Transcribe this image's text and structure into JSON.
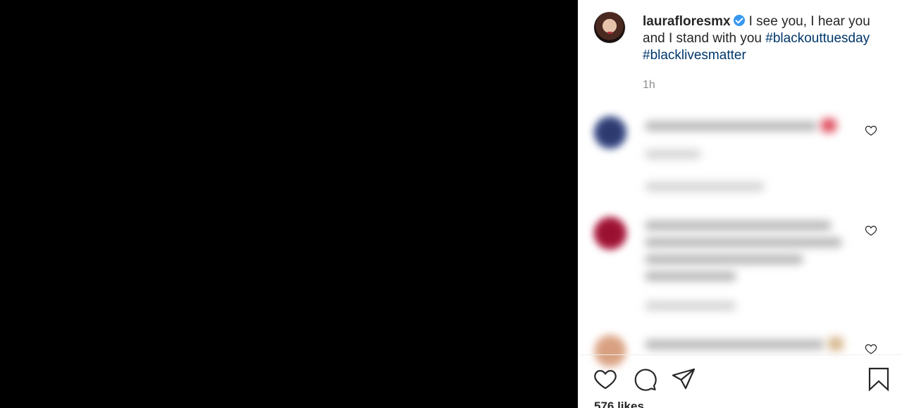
{
  "post": {
    "username": "laurafloresmx",
    "caption_text": "I see you, I hear you and I stand with you",
    "hashtags": [
      "#blackouttuesday",
      "#blacklivesmatter"
    ],
    "time": "1h"
  },
  "actions": {
    "like_icon": "heart-icon",
    "comment_icon": "comment-icon",
    "share_icon": "share-icon",
    "save_icon": "bookmark-icon"
  },
  "likes_text": "576 likes",
  "colors": {
    "link": "#00376b",
    "verified": "#3897f0",
    "meta": "#8e8e8e",
    "text": "#262626"
  }
}
